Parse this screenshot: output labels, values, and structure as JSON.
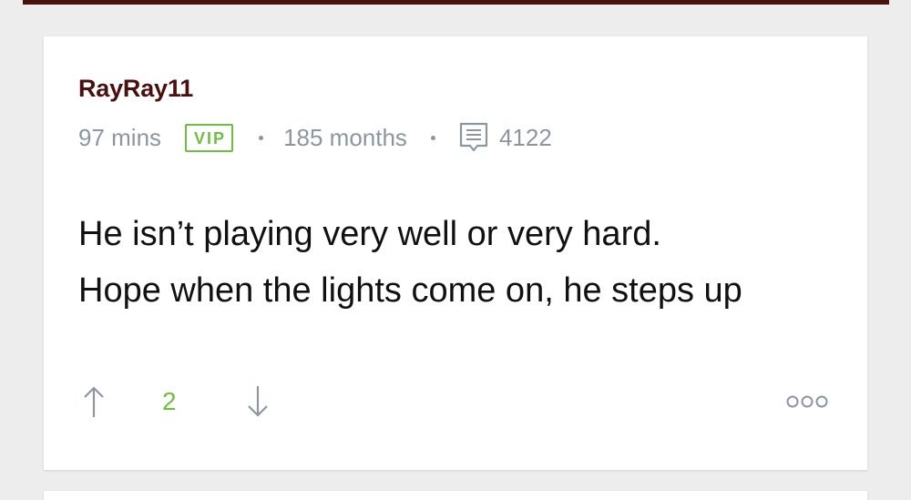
{
  "comment": {
    "username": "RayRay11",
    "time_ago": "97 mins",
    "badge": "VIP",
    "membership": "185 months",
    "post_count": "4122",
    "body_line1": "He isn’t playing very well or very hard.",
    "body_line2": "Hope when the lights come on, he steps up",
    "vote_count": "2"
  },
  "icons": {
    "upvote": "arrow-up-icon",
    "downvote": "arrow-down-icon",
    "posts": "comment-bubble-icon",
    "more": "more-options-icon"
  },
  "colors": {
    "username": "#4a0f0f",
    "accent_green": "#6cbf3f",
    "meta_gray": "#8c96a3",
    "top_bar": "#4a0f0f"
  }
}
